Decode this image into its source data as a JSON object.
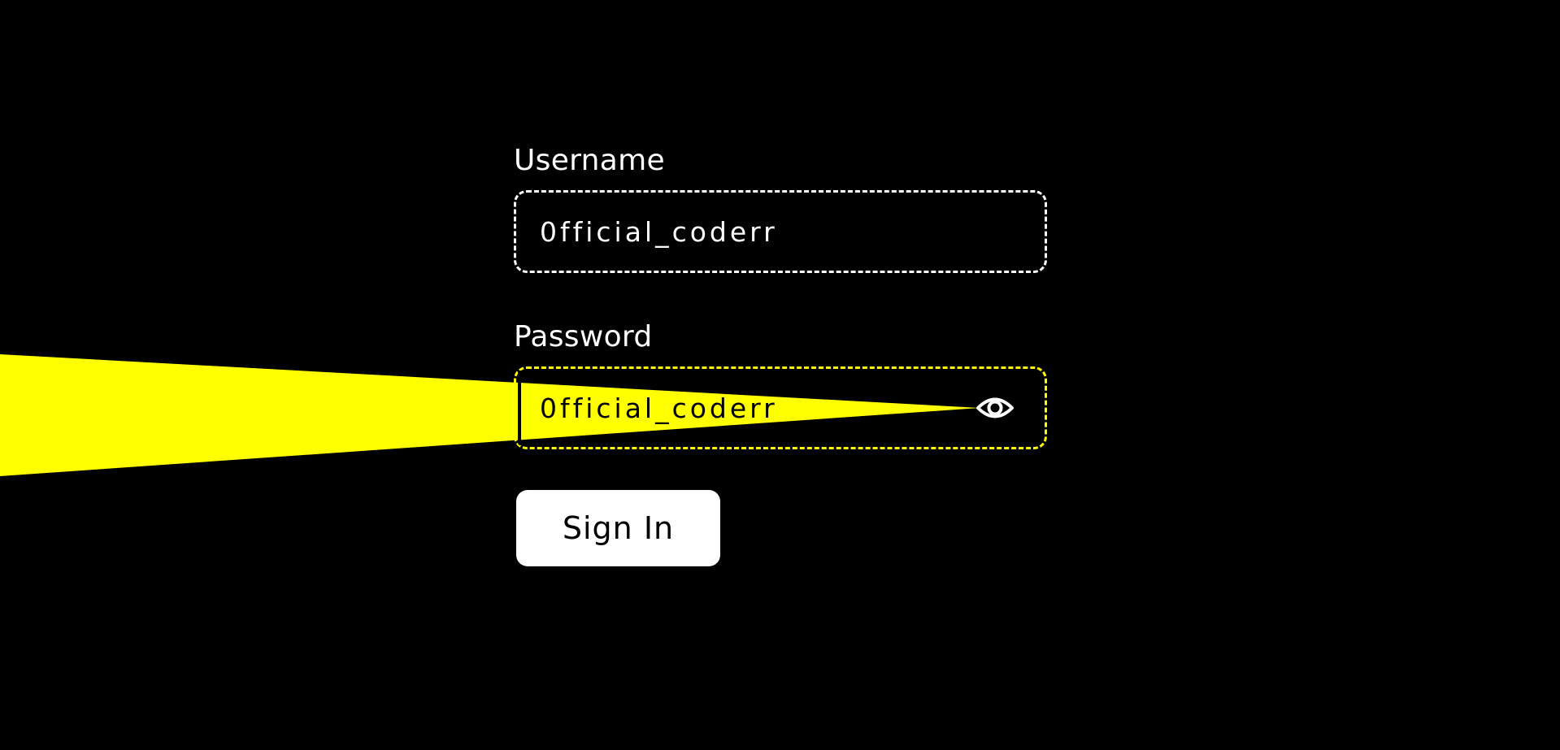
{
  "form": {
    "username": {
      "label": "Username",
      "value": "0fficial_coderr"
    },
    "password": {
      "label": "Password",
      "value": "0fficial_coderr",
      "toggle_icon": "eye-icon"
    },
    "submit_label": "Sign In"
  },
  "colors": {
    "background": "#000000",
    "foreground": "#ffffff",
    "accent": "#ffff00"
  }
}
